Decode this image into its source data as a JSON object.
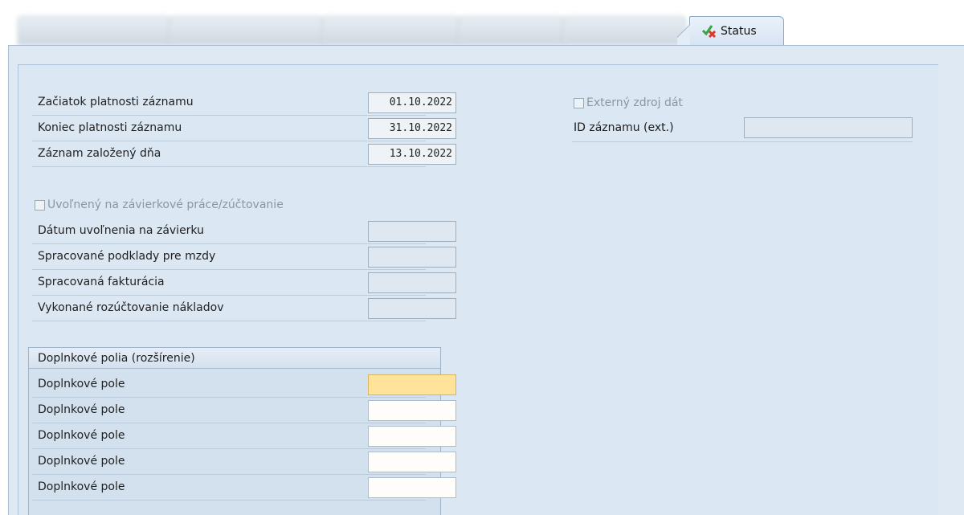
{
  "tabs": {
    "active_label": "Status"
  },
  "dates": {
    "start_label": "Začiatok platnosti záznamu",
    "start_value": "01.10.2022",
    "end_label": "Koniec platnosti záznamu",
    "end_value": "31.10.2022",
    "created_label": "Záznam založený dňa",
    "created_value": "13.10.2022"
  },
  "external": {
    "checkbox_label": "Externý zdroj dát",
    "id_label": "ID záznamu (ext.)",
    "id_value": ""
  },
  "release": {
    "checkbox_label": "Uvoľnený na závierkové práce/zúčtovanie",
    "rows": [
      {
        "label": "Dátum uvoľnenia na závierku",
        "value": ""
      },
      {
        "label": "Spracované podklady pre mzdy",
        "value": ""
      },
      {
        "label": "Spracovaná fakturácia",
        "value": ""
      },
      {
        "label": "Vykonané rozúčtovanie nákladov",
        "value": ""
      }
    ]
  },
  "extra_fields": {
    "title": "Doplnkové polia (rozšírenie)",
    "rows": [
      {
        "label": "Doplnkové pole",
        "value": ""
      },
      {
        "label": "Doplnkové pole",
        "value": ""
      },
      {
        "label": "Doplnkové pole",
        "value": ""
      },
      {
        "label": "Doplnkové pole",
        "value": ""
      },
      {
        "label": "Doplnkové pole",
        "value": ""
      }
    ]
  }
}
